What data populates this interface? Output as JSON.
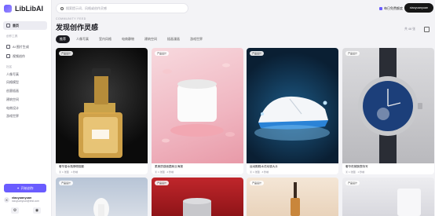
{
  "brand": {
    "name": "LibLibAI"
  },
  "sidebar": {
    "items": [
      {
        "label": "首页",
        "icon": "home-icon"
      },
      {
        "label": "AI 图片生成",
        "icon": "image-icon"
      },
      {
        "label": "视频创作",
        "icon": "video-icon"
      }
    ],
    "section1": "创作工具",
    "section2": "社区",
    "links": [
      "人像写真",
      "风格模型",
      "创意插画",
      "建筑空间",
      "电商设计",
      "游戏世界"
    ],
    "cta_label": "开始创作",
    "user_name": "xiaoyuanyuan",
    "user_email": "xiaoyuanyuan@test.com",
    "user_initial": "X"
  },
  "topbar": {
    "search_placeholder": "搜索提示词、风格或创作灵感",
    "link_label": "每日免费额度",
    "user_label": "xiaoyuanyuan"
  },
  "header": {
    "eyebrow": "COMMUNITY FEED",
    "title": "发现创作灵感",
    "count": "共 48 张"
  },
  "tabs": [
    "推荐",
    "人像写真",
    "室内风格",
    "电商静物",
    "建筑空间",
    "插画漫画",
    "游戏世界"
  ],
  "cards": [
    {
      "tag": "产品设计",
      "caption": "奢华香水瓶静物摄影",
      "meta": "▣ 1 张图 · 1 秒前"
    },
    {
      "tag": "产品设计",
      "caption": "柔美质感面霜商业海报",
      "meta": "▣ 1 张图 · 2 秒前"
    },
    {
      "tag": "产品设计",
      "caption": "运动跑鞋水花动感大片",
      "meta": "▣ 1 张图 · 3 秒前"
    },
    {
      "tag": "产品设计",
      "caption": "奢华机械腕表特写",
      "meta": "▣ 1 张图 · 1 秒前"
    }
  ],
  "cards_row2": [
    {
      "tag": "产品设计"
    },
    {
      "tag": "产品设计"
    },
    {
      "tag": "产品设计"
    },
    {
      "tag": "产品设计"
    }
  ],
  "colors": {
    "accent": "#6a5cff",
    "dark": "#1a1a1f"
  }
}
